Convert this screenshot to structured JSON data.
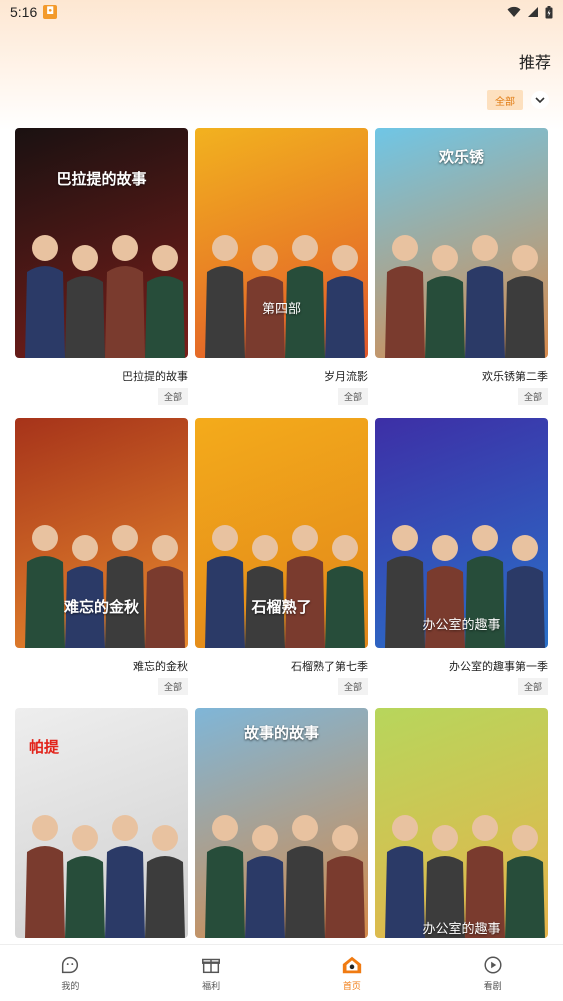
{
  "status_bar": {
    "time": "5:16"
  },
  "header": {
    "tab_label": "推荐"
  },
  "filter": {
    "chip_label": "全部"
  },
  "cards": [
    {
      "title": "巴拉提的故事",
      "badge": "全部",
      "poster_text": "巴拉提的故事",
      "colors": [
        "#1a1111",
        "#7a1e1a"
      ]
    },
    {
      "title": "岁月流影",
      "badge": "全部",
      "poster_text": "第四部",
      "colors": [
        "#f2b21f",
        "#e1572a"
      ]
    },
    {
      "title": "欢乐锈第二季",
      "badge": "全部",
      "poster_text": "欢乐锈",
      "colors": [
        "#6fc6e6",
        "#d88a4b"
      ]
    },
    {
      "title": "难忘的金秋",
      "badge": "全部",
      "poster_text": "难忘的金秋",
      "colors": [
        "#a6331a",
        "#e98b2e"
      ]
    },
    {
      "title": "石榴熟了第七季",
      "badge": "全部",
      "poster_text": "石榴熟了",
      "colors": [
        "#f4ab1b",
        "#e1861a"
      ]
    },
    {
      "title": "办公室的趣事第一季",
      "badge": "全部",
      "poster_text": "办公室的趣事",
      "colors": [
        "#3d2fa6",
        "#2a71c9"
      ]
    },
    {
      "title": "",
      "badge": "",
      "poster_text": "帕提",
      "colors": [
        "#eeeeee",
        "#cfcfcf"
      ]
    },
    {
      "title": "",
      "badge": "",
      "poster_text": "故事的故事",
      "colors": [
        "#7fb6d8",
        "#d48a4a"
      ]
    },
    {
      "title": "",
      "badge": "",
      "poster_text": "办公室的趣事",
      "colors": [
        "#b7d65c",
        "#e6b34a"
      ]
    }
  ],
  "bottom_nav": [
    {
      "label": "我的",
      "icon": "face-icon",
      "active": false
    },
    {
      "label": "福利",
      "icon": "gift-icon",
      "active": false
    },
    {
      "label": "首页",
      "icon": "home-icon",
      "active": true
    },
    {
      "label": "看剧",
      "icon": "play-icon",
      "active": false
    }
  ],
  "colors": {
    "accent": "#f07b12",
    "chip_bg": "#fde0bf"
  }
}
